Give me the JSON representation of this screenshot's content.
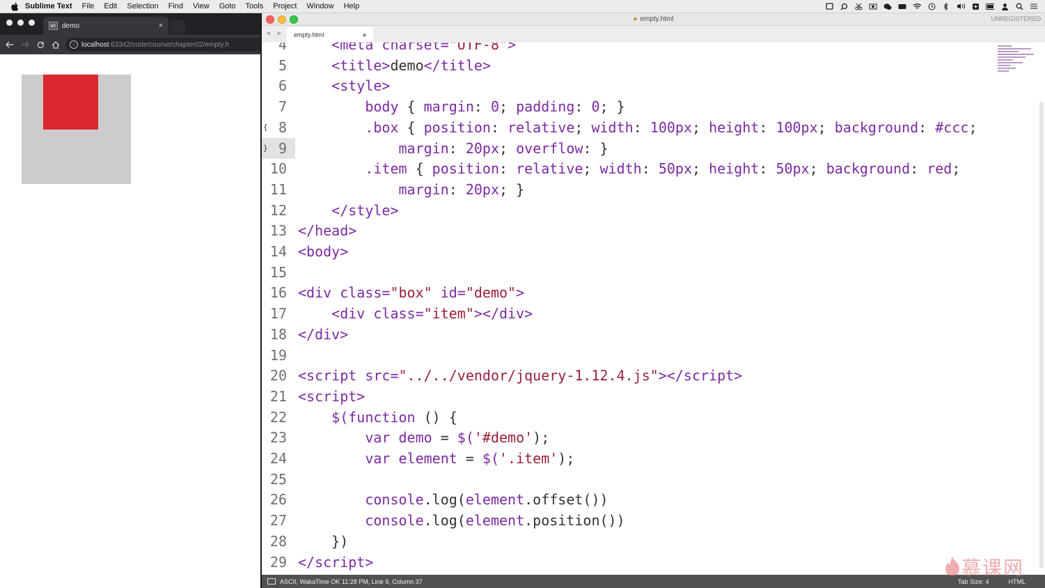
{
  "menubar": {
    "app": "Sublime Text",
    "items": [
      "File",
      "Edit",
      "Selection",
      "Find",
      "View",
      "Goto",
      "Tools",
      "Project",
      "Window",
      "Help"
    ]
  },
  "browser": {
    "tab_title": "demo",
    "tab_favicon": "WS",
    "tab_close": "×",
    "url_host": "localhost",
    "url_path": ":63342/code/course/chapter02/empty.h",
    "box_color": "#cccccc",
    "item_color": "#dc2730"
  },
  "editor": {
    "window_title": "empty.html",
    "unregistered": "UNREGISTERED",
    "tab_name": "empty.html",
    "lines": [
      {
        "n": "4",
        "html": "    <span class='tg'>&lt;meta charset=</span><span class='st'>\"UTF-8\"</span><span class='tg'>&gt;</span>"
      },
      {
        "n": "5",
        "html": "    <span class='tg'>&lt;title&gt;</span>demo<span class='tg'>&lt;/title&gt;</span>"
      },
      {
        "n": "6",
        "html": "    <span class='tg'>&lt;style&gt;</span>"
      },
      {
        "n": "7",
        "html": "        <span class='tg'>body</span> { <span class='tg'>margin</span>: <span class='nm'>0</span>; <span class='tg'>padding</span>: <span class='nm'>0</span>; }"
      },
      {
        "n": "8",
        "html": "        <span class='tg'>.box</span> { <span class='tg'>position</span>: <span class='tg'>relative</span>; <span class='tg'>width</span>: <span class='nm'>100px</span>; <span class='tg'>height</span>: <span class='nm'>100px</span>; <span class='tg'>background</span>: <span class='tg'>#ccc</span>;"
      },
      {
        "n": "9",
        "html": "            <span class='tg'>margin</span>: <span class='nm'>20px</span>; <span class='tg'>overflow</span>: }"
      },
      {
        "n": "10",
        "html": "        <span class='tg'>.item</span> { <span class='tg'>position</span>: <span class='tg'>relative</span>; <span class='tg'>width</span>: <span class='nm'>50px</span>; <span class='tg'>height</span>: <span class='nm'>50px</span>; <span class='tg'>background</span>: <span class='tg'>red</span>;"
      },
      {
        "n": "11",
        "html": "            <span class='tg'>margin</span>: <span class='nm'>20px</span>; }"
      },
      {
        "n": "12",
        "html": "    <span class='tg'>&lt;/style&gt;</span>"
      },
      {
        "n": "13",
        "html": "<span class='tg'>&lt;/head&gt;</span>"
      },
      {
        "n": "14",
        "html": "<span class='tg'>&lt;body&gt;</span>"
      },
      {
        "n": "15",
        "html": ""
      },
      {
        "n": "16",
        "html": "<span class='tg'>&lt;div class=</span><span class='st'>\"box\"</span> <span class='tg'>id=</span><span class='st'>\"demo\"</span><span class='tg'>&gt;</span>"
      },
      {
        "n": "17",
        "html": "    <span class='tg'>&lt;div class=</span><span class='st'>\"item\"</span><span class='tg'>&gt;&lt;/div&gt;</span>"
      },
      {
        "n": "18",
        "html": "<span class='tg'>&lt;/div&gt;</span>"
      },
      {
        "n": "19",
        "html": ""
      },
      {
        "n": "20",
        "html": "<span class='tg'>&lt;script src=</span><span class='st'>\"../../vendor/jquery-1.12.4.js\"</span><span class='tg'>&gt;&lt;/script&gt;</span>"
      },
      {
        "n": "21",
        "html": "<span class='tg'>&lt;script&gt;</span>"
      },
      {
        "n": "22",
        "html": "    <span class='fn'>$(function</span> () {"
      },
      {
        "n": "23",
        "html": "        <span class='kw'>var demo</span> = <span class='fn'>$(</span><span class='st'>'#demo'</span>);"
      },
      {
        "n": "24",
        "html": "        <span class='kw'>var element</span> = <span class='fn'>$(</span><span class='st'>'.item'</span>);"
      },
      {
        "n": "25",
        "html": ""
      },
      {
        "n": "26",
        "html": "        <span class='fn'>console</span>.log(<span class='fn'>element</span>.offset())"
      },
      {
        "n": "27",
        "html": "        <span class='fn'>console</span>.log(<span class='fn'>element</span>.position())"
      },
      {
        "n": "28",
        "html": "    })"
      },
      {
        "n": "29",
        "html": "<span class='tg'>&lt;/script&gt;</span>"
      }
    ]
  },
  "status": {
    "left": "ASCII, WakaTime OK 11:28 PM, Line 9, Column 37",
    "tab_size": "Tab Size: 4",
    "syntax": "HTML"
  },
  "watermark": "慕课网"
}
